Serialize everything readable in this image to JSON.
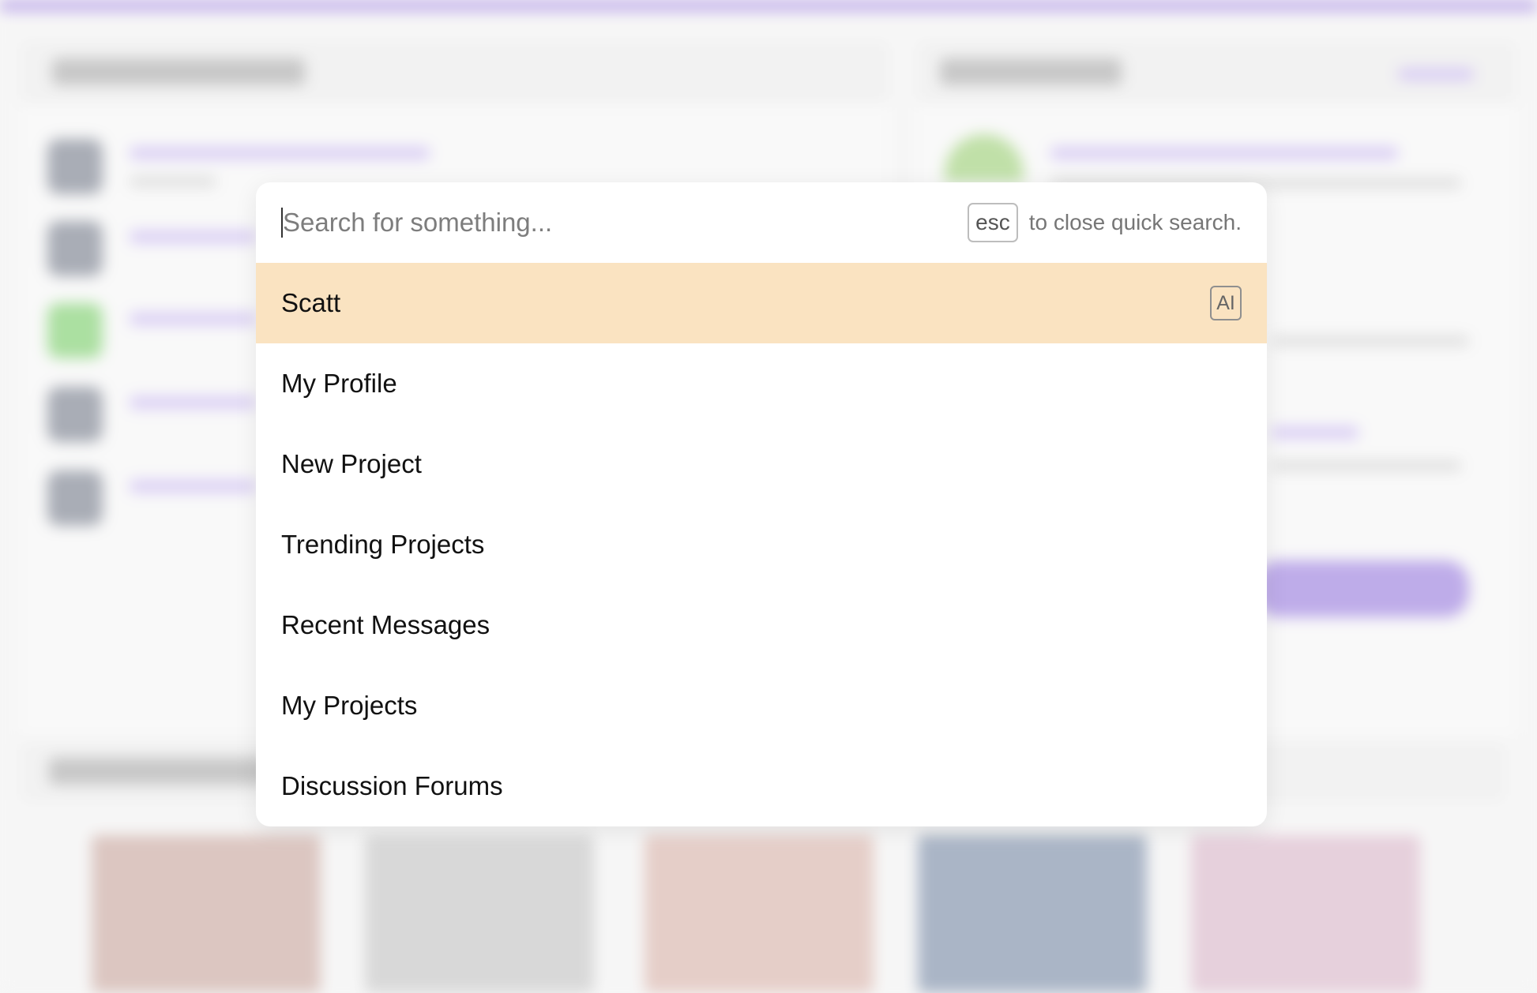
{
  "search": {
    "placeholder": "Search for something...",
    "esc_key": "esc",
    "esc_hint": "to close quick search."
  },
  "results": [
    {
      "label": "Scatt",
      "badge": "AI",
      "active": true
    },
    {
      "label": "My Profile"
    },
    {
      "label": "New Project"
    },
    {
      "label": "Trending Projects"
    },
    {
      "label": "Recent Messages"
    },
    {
      "label": "My Projects"
    },
    {
      "label": "Discussion Forums"
    }
  ],
  "colors": {
    "highlight": "#fae3c1",
    "accent": "#9d7fe0"
  }
}
